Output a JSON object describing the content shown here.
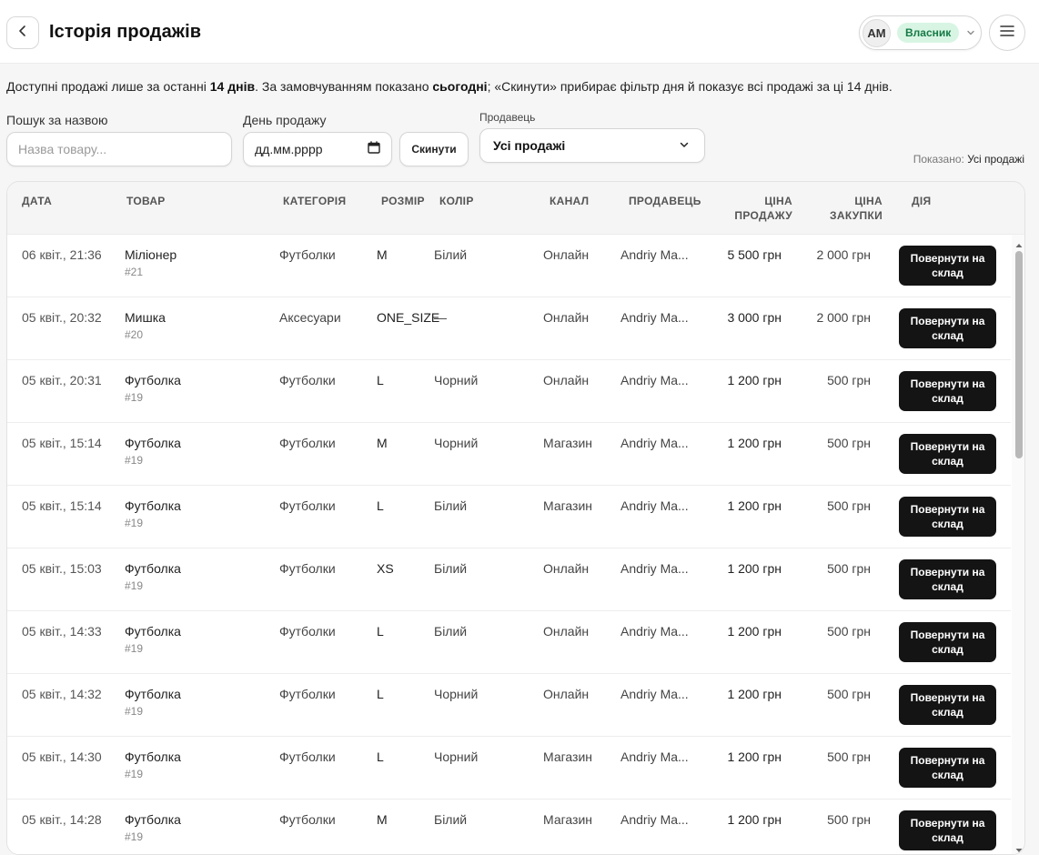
{
  "header": {
    "title": "Історія продажів",
    "user_initials": "AM",
    "role": "Власник"
  },
  "info": {
    "part1": "Доступні продажі лише за останні ",
    "days": "14 днів",
    "part2": ". За замовчуванням показано ",
    "today": "сьогодні",
    "part3": "; «Скинути» прибирає фільтр дня й показує всі продажі за ці 14 днів."
  },
  "filters": {
    "search_label": "Пошук за назвою",
    "search_placeholder": "Назва товару...",
    "date_label": "День продажу",
    "date_placeholder": "дд.мм.рррр",
    "reset_label": "Скинути",
    "seller_label": "Продавець",
    "seller_value": "Усі продажі",
    "shown_label": "Показано:",
    "shown_value": "Усі продажі"
  },
  "table": {
    "headers": {
      "date": "ДАТА",
      "product": "ТОВАР",
      "category": "КАТЕГОРІЯ",
      "size": "РОЗМІР",
      "color": "КОЛІР",
      "channel": "КАНАЛ",
      "seller": "ПРОДАВЕЦЬ",
      "sale_price_1": "ЦІНА",
      "sale_price_2": "ПРОДАЖУ",
      "purchase_price_1": "ЦІНА",
      "purchase_price_2": "ЗАКУПКИ",
      "action": "ДІЯ"
    },
    "action_label_1": "Повернути на",
    "action_label_2": "склад",
    "rows": [
      {
        "date": "06 квіт., 21:36",
        "product": "Міліонер",
        "id": "#21",
        "category": "Футболки",
        "size": "M",
        "color": "Білий",
        "channel": "Онлайн",
        "seller": "Andriy Ma...",
        "sale": "5 500 грн",
        "purchase": "2 000 грн"
      },
      {
        "date": "05 квіт., 20:32",
        "product": "Мишка",
        "id": "#20",
        "category": "Аксесуари",
        "size": "ONE_SIZE",
        "color": "—",
        "channel": "Онлайн",
        "seller": "Andriy Ma...",
        "sale": "3 000 грн",
        "purchase": "2 000 грн"
      },
      {
        "date": "05 квіт., 20:31",
        "product": "Футболка",
        "id": "#19",
        "category": "Футболки",
        "size": "L",
        "color": "Чорний",
        "channel": "Онлайн",
        "seller": "Andriy Ma...",
        "sale": "1 200 грн",
        "purchase": "500 грн"
      },
      {
        "date": "05 квіт., 15:14",
        "product": "Футболка",
        "id": "#19",
        "category": "Футболки",
        "size": "M",
        "color": "Чорний",
        "channel": "Магазин",
        "seller": "Andriy Ma...",
        "sale": "1 200 грн",
        "purchase": "500 грн"
      },
      {
        "date": "05 квіт., 15:14",
        "product": "Футболка",
        "id": "#19",
        "category": "Футболки",
        "size": "L",
        "color": "Білий",
        "channel": "Магазин",
        "seller": "Andriy Ma...",
        "sale": "1 200 грн",
        "purchase": "500 грн"
      },
      {
        "date": "05 квіт., 15:03",
        "product": "Футболка",
        "id": "#19",
        "category": "Футболки",
        "size": "XS",
        "color": "Білий",
        "channel": "Онлайн",
        "seller": "Andriy Ma...",
        "sale": "1 200 грн",
        "purchase": "500 грн"
      },
      {
        "date": "05 квіт., 14:33",
        "product": "Футболка",
        "id": "#19",
        "category": "Футболки",
        "size": "L",
        "color": "Білий",
        "channel": "Онлайн",
        "seller": "Andriy Ma...",
        "sale": "1 200 грн",
        "purchase": "500 грн"
      },
      {
        "date": "05 квіт., 14:32",
        "product": "Футболка",
        "id": "#19",
        "category": "Футболки",
        "size": "L",
        "color": "Чорний",
        "channel": "Онлайн",
        "seller": "Andriy Ma...",
        "sale": "1 200 грн",
        "purchase": "500 грн"
      },
      {
        "date": "05 квіт., 14:30",
        "product": "Футболка",
        "id": "#19",
        "category": "Футболки",
        "size": "L",
        "color": "Чорний",
        "channel": "Магазин",
        "seller": "Andriy Ma...",
        "sale": "1 200 грн",
        "purchase": "500 грн"
      },
      {
        "date": "05 квіт., 14:28",
        "product": "Футболка",
        "id": "#19",
        "category": "Футболки",
        "size": "M",
        "color": "Білий",
        "channel": "Магазин",
        "seller": "Andriy Ma...",
        "sale": "1 200 грн",
        "purchase": "500 грн"
      }
    ]
  },
  "icons": {
    "back": "chevron-left-icon",
    "chip": "chevron-down-icon",
    "menu": "hamburger-menu-icon",
    "calendar": "calendar-icon",
    "select": "chevron-down-icon"
  },
  "colors": {
    "badge_bg": "#d8f5e4",
    "badge_text": "#167a45",
    "action_button": "#141414"
  }
}
